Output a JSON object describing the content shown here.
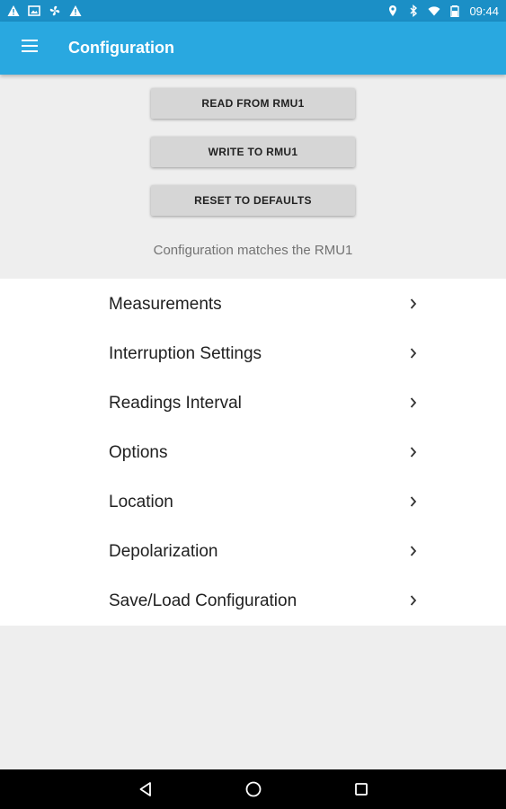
{
  "status_bar": {
    "time": "09:44",
    "left_icons": [
      "warning-icon",
      "image-icon",
      "fan-icon",
      "warning-icon"
    ],
    "right_icons": [
      "location-icon",
      "bluetooth-icon",
      "wifi-icon",
      "battery-icon"
    ]
  },
  "app_bar": {
    "menu_icon": "hamburger-menu-icon",
    "title": "Configuration",
    "color": "#29a8e0"
  },
  "actions": {
    "read_label": "READ FROM RMU1",
    "write_label": "WRITE TO RMU1",
    "reset_label": "RESET TO DEFAULTS",
    "status_text": "Configuration matches the RMU1"
  },
  "menu": {
    "items": [
      {
        "label": "Measurements"
      },
      {
        "label": "Interruption Settings"
      },
      {
        "label": "Readings Interval"
      },
      {
        "label": "Options"
      },
      {
        "label": "Location"
      },
      {
        "label": "Depolarization"
      },
      {
        "label": "Save/Load Configuration"
      }
    ]
  },
  "nav_bar": {
    "icons": [
      "back-icon",
      "home-icon",
      "recents-icon"
    ]
  }
}
